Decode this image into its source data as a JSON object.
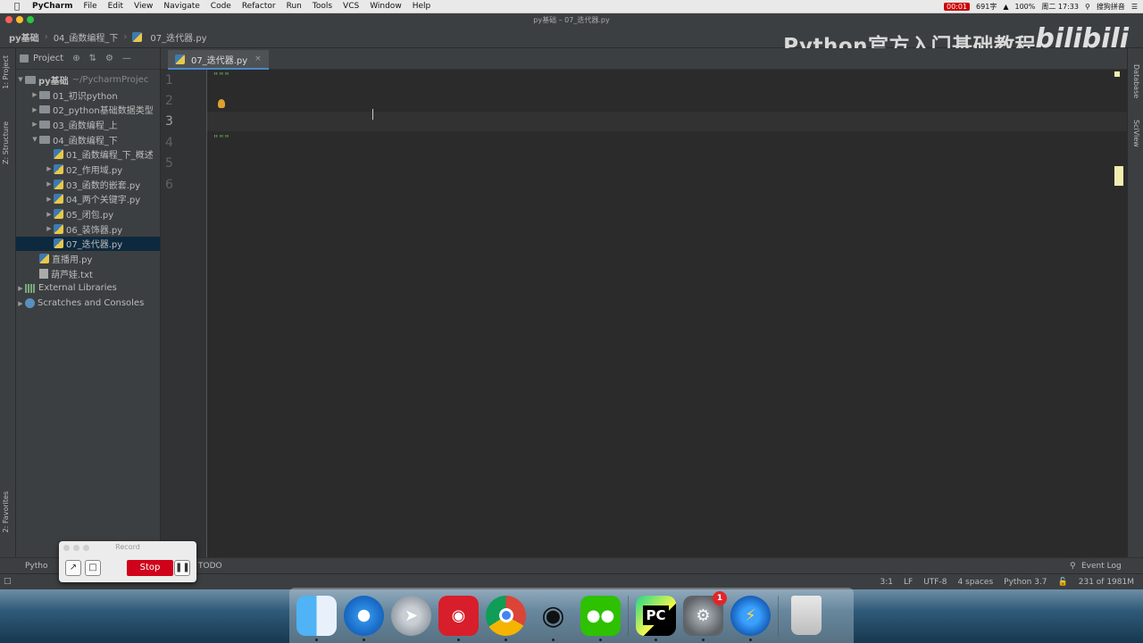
{
  "menubar": {
    "app_name": "PyCharm",
    "items": [
      "File",
      "Edit",
      "View",
      "Navigate",
      "Code",
      "Refactor",
      "Run",
      "Tools",
      "VCS",
      "Window",
      "Help"
    ],
    "rec_time": "00:01",
    "word_count": "691字",
    "battery": "100%",
    "datetime": "周二 17:33",
    "ime": "搜狗拼音"
  },
  "window": {
    "title": "py基础 – 07_迭代器.py"
  },
  "breadcrumb": [
    "py基础",
    "04_函数编程_下",
    "07_迭代器.py"
  ],
  "watermark": {
    "text": "Python官方入门基础教程",
    "logo": "bilibili"
  },
  "project_panel": {
    "header": "Project",
    "root": {
      "name": "py基础",
      "path": "~/PycharmProjec"
    },
    "items": [
      {
        "label": "01_初识python",
        "type": "folder",
        "depth": 1,
        "expanded": false
      },
      {
        "label": "02_python基础数据类型",
        "type": "folder",
        "depth": 1,
        "expanded": false
      },
      {
        "label": "03_函数编程_上",
        "type": "folder",
        "depth": 1,
        "expanded": false
      },
      {
        "label": "04_函数编程_下",
        "type": "folder",
        "depth": 1,
        "expanded": true
      },
      {
        "label": "01_函数编程_下_概述",
        "type": "py",
        "depth": 2,
        "expanded": null
      },
      {
        "label": "02_作用域.py",
        "type": "py",
        "depth": 2,
        "expanded": false
      },
      {
        "label": "03_函数的嵌套.py",
        "type": "py",
        "depth": 2,
        "expanded": false
      },
      {
        "label": "04_两个关键字.py",
        "type": "py",
        "depth": 2,
        "expanded": false
      },
      {
        "label": "05_闭包.py",
        "type": "py",
        "depth": 2,
        "expanded": false
      },
      {
        "label": "06_装饰器.py",
        "type": "py",
        "depth": 2,
        "expanded": false
      },
      {
        "label": "07_迭代器.py",
        "type": "py",
        "depth": 2,
        "expanded": null,
        "selected": true
      },
      {
        "label": "直播用.py",
        "type": "py",
        "depth": 1,
        "expanded": null
      },
      {
        "label": "葫芦娃.txt",
        "type": "txt",
        "depth": 1,
        "expanded": null
      },
      {
        "label": "External Libraries",
        "type": "lib",
        "depth": 0,
        "expanded": false
      },
      {
        "label": "Scratches and Consoles",
        "type": "scratch",
        "depth": 0,
        "expanded": false
      }
    ]
  },
  "side_tabs": {
    "project": "1: Project",
    "structure": "Z: Structure",
    "favorites": "2: Favorites",
    "database": "Database",
    "sciview": "SciView"
  },
  "editor": {
    "tab_label": "07_迭代器.py",
    "line_numbers": [
      "1",
      "2",
      "3",
      "4",
      "5",
      "6"
    ],
    "lines": {
      "1": "\"\"\"",
      "4": "\"\"\""
    }
  },
  "bottom_tools": {
    "python_console": "Pytho",
    "todo": "TODO",
    "event_log": "Event Log"
  },
  "status": {
    "position": "3:1",
    "line_sep": "LF",
    "encoding": "UTF-8",
    "indent": "4 spaces",
    "interpreter": "Python 3.7",
    "memory": "231 of 1981M"
  },
  "recorder": {
    "title": "Record",
    "stop_label": "Stop"
  },
  "dock": {
    "apps": [
      "finder-icon",
      "safari-icon",
      "launchpad-icon",
      "netease-music-icon",
      "chrome-icon",
      "qq-icon",
      "wechat-icon",
      "pycharm-icon",
      "system-preferences-icon",
      "thunder-icon",
      "trash-icon"
    ],
    "pycharm_label": "PC",
    "prefs_badge": "1"
  }
}
